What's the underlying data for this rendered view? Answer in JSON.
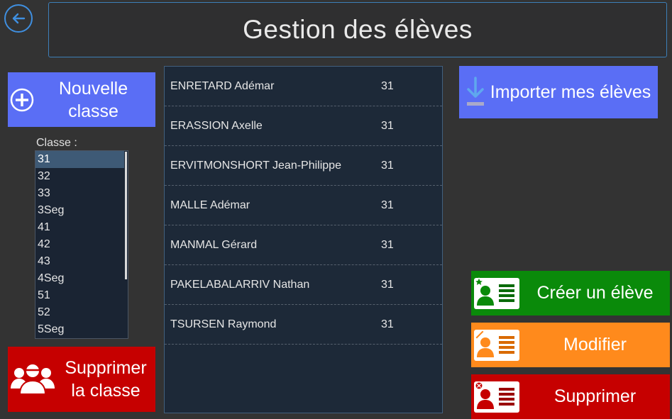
{
  "header": {
    "title": "Gestion des élèves"
  },
  "left": {
    "new_class_label": "Nouvelle classe",
    "class_label": "Classe :",
    "classes": [
      "31",
      "32",
      "33",
      "3Seg",
      "41",
      "42",
      "43",
      "4Seg",
      "51",
      "52",
      "5Seg"
    ],
    "selected_class": "31",
    "delete_class_label": "Supprimer la classe"
  },
  "students": [
    {
      "name": "ENRETARD Adémar",
      "class": "31"
    },
    {
      "name": "ERASSION Axelle",
      "class": "31"
    },
    {
      "name": "ERVITMONSHORT Jean-Philippe",
      "class": "31"
    },
    {
      "name": "MALLE Adémar",
      "class": "31"
    },
    {
      "name": "MANMAL Gérard",
      "class": "31"
    },
    {
      "name": "PAKELABALARRIV Nathan",
      "class": "31"
    },
    {
      "name": "TSURSEN Raymond",
      "class": "31"
    }
  ],
  "right": {
    "import_label": "Importer mes élèves",
    "create_label": "Créer un élève",
    "modify_label": "Modifier",
    "delete_label": "Supprimer"
  },
  "colors": {
    "background": "#333333",
    "accent_blue": "#5a6ef5",
    "green": "#0a8a0a",
    "orange": "#ff8a1c",
    "red": "#c60000",
    "list_bg": "#1d2938"
  },
  "icons": {
    "back": "arrow-left-circle-icon",
    "new_class": "plus-circle-icon",
    "delete_class": "group-icon",
    "import": "download-icon",
    "create": "id-card-star-icon",
    "modify": "id-card-pencil-icon",
    "delete": "id-card-x-icon"
  }
}
